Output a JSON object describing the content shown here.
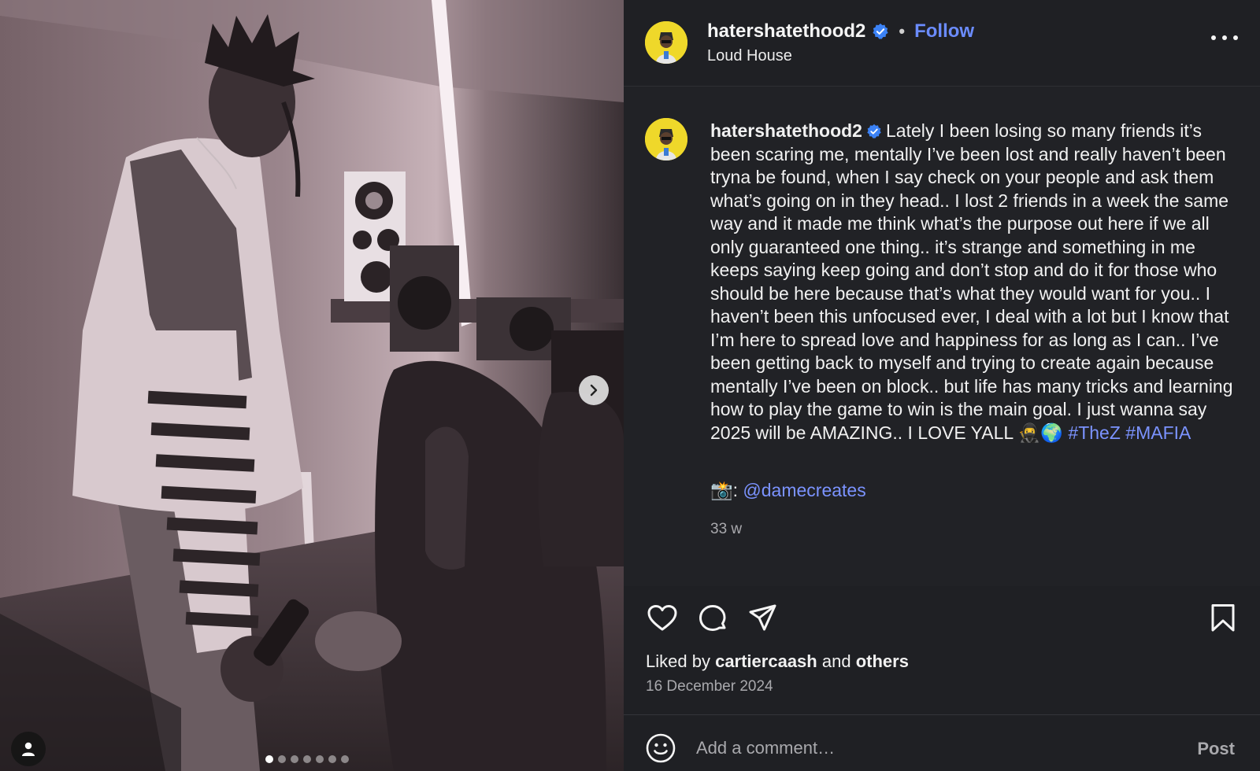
{
  "header": {
    "username": "hatershatethood2",
    "separator": "•",
    "follow_label": "Follow",
    "location": "Loud House"
  },
  "caption": {
    "username": "hatershatethood2",
    "text": "Lately I been losing so many friends it’s been scaring me, mentally I’ve been lost and really haven’t been tryna be found, when I say check on your people and ask them what’s going on in they head.. I lost 2 friends in a week the same way and it made me think what’s the purpose out here if we all only guaranteed one thing.. it’s strange and something in me keeps saying keep going and don’t stop and do it for those who should be here because that’s what they would want for you.. I haven’t been this unfocused ever, I deal with a lot but I know that I’m here to spread love and happiness for as long as I can.. I’ve been getting back to myself and trying to create again because mentally I’ve been on block.. but life has many tricks and learning how to play the game to win is the main goal. I just wanna say 2025 will be AMAZING.. I LOVE YALL 🥷🌍",
    "hashtags": [
      "#TheZ",
      "#MAFIA"
    ],
    "credit_prefix": "📸:",
    "credit_mention": "@damecreates",
    "time_ago": "33 w"
  },
  "likes": {
    "prefix": "Liked by",
    "user": "cartiercaash",
    "middle": "and",
    "others": "others"
  },
  "post_date": "16 December 2024",
  "comment": {
    "placeholder": "Add a comment…",
    "post_label": "Post"
  },
  "carousel": {
    "total_slides": 7,
    "active_index": 0
  },
  "icons": {
    "like": "heart-icon",
    "comment": "comment-icon",
    "share": "share-icon",
    "save": "bookmark-icon",
    "more": "more-options-icon",
    "next": "chevron-right-icon",
    "tag": "user-tag-icon",
    "emoji": "emoji-icon",
    "verified": "verified-badge-icon"
  },
  "colors": {
    "accent": "#6b8cff",
    "link": "#7b93ff",
    "verified": "#3b82f6",
    "background": "#212226"
  }
}
